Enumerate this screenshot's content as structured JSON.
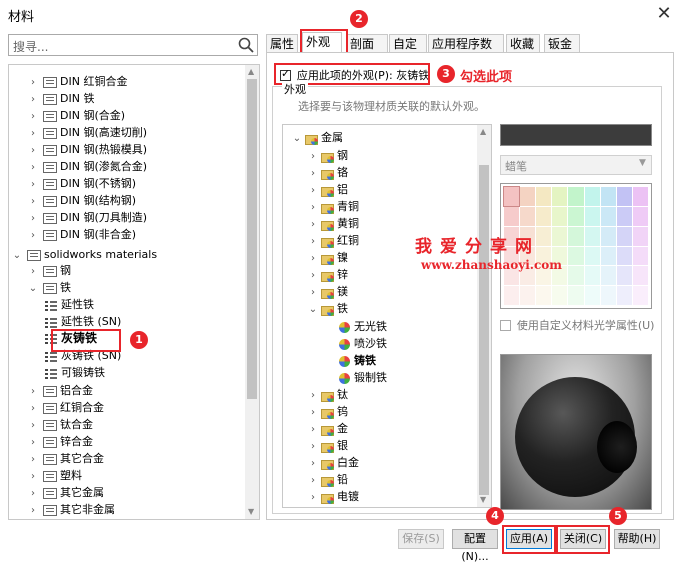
{
  "window": {
    "title": "材料",
    "close_glyph": "✕"
  },
  "search": {
    "placeholder": "搜寻..."
  },
  "left_tree": {
    "items": [
      {
        "label": "DIN 红铜合金",
        "type": "folder"
      },
      {
        "label": "DIN 铁",
        "type": "folder"
      },
      {
        "label": "DIN 钢(合金)",
        "type": "folder"
      },
      {
        "label": "DIN 钢(高速切削)",
        "type": "folder"
      },
      {
        "label": "DIN 钢(热锻模具)",
        "type": "folder"
      },
      {
        "label": "DIN 钢(渗氮合金)",
        "type": "folder"
      },
      {
        "label": "DIN 钢(不锈钢)",
        "type": "folder"
      },
      {
        "label": "DIN 钢(结构钢)",
        "type": "folder"
      },
      {
        "label": "DIN 钢(刀具制造)",
        "type": "folder"
      },
      {
        "label": "DIN 钢(非合金)",
        "type": "folder"
      },
      {
        "label": "solidworks materials",
        "type": "library"
      },
      {
        "label": "钢",
        "type": "folder"
      },
      {
        "label": "铁",
        "type": "folder"
      },
      {
        "label": "延性铁",
        "type": "material"
      },
      {
        "label": "延性铁 (SN)",
        "type": "material"
      },
      {
        "label": "灰铸铁",
        "type": "material"
      },
      {
        "label": "灰铸铁 (SN)",
        "type": "material"
      },
      {
        "label": "可锻铸铁",
        "type": "material"
      },
      {
        "label": "铝合金",
        "type": "folder"
      },
      {
        "label": "红铜合金",
        "type": "folder"
      },
      {
        "label": "钛合金",
        "type": "folder"
      },
      {
        "label": "锌合金",
        "type": "folder"
      },
      {
        "label": "其它合金",
        "type": "folder"
      },
      {
        "label": "塑料",
        "type": "folder"
      },
      {
        "label": "其它金属",
        "type": "folder"
      },
      {
        "label": "其它非金属",
        "type": "folder"
      }
    ]
  },
  "tabs": [
    {
      "label": "属性"
    },
    {
      "label": "外观"
    },
    {
      "label": "剖面线"
    },
    {
      "label": "自定义"
    },
    {
      "label": "应用程序数据"
    },
    {
      "label": "收藏"
    },
    {
      "label": "钣金"
    }
  ],
  "appearance": {
    "apply_checkbox_label": "应用此项的外观(P): 灰铸铁",
    "group_title": "外观",
    "description": "选择要与该物理材质关联的默认外观。",
    "tree": [
      {
        "label": "金属",
        "type": "folder"
      },
      {
        "label": "钢",
        "type": "folder"
      },
      {
        "label": "铬",
        "type": "folder"
      },
      {
        "label": "铝",
        "type": "folder"
      },
      {
        "label": "青铜",
        "type": "folder"
      },
      {
        "label": "黄铜",
        "type": "folder"
      },
      {
        "label": "红铜",
        "type": "folder"
      },
      {
        "label": "镍",
        "type": "folder"
      },
      {
        "label": "锌",
        "type": "folder"
      },
      {
        "label": "镁",
        "type": "folder"
      },
      {
        "label": "铁",
        "type": "folder"
      },
      {
        "label": "无光铁",
        "type": "item"
      },
      {
        "label": "喷沙铁",
        "type": "item"
      },
      {
        "label": "铸铁",
        "type": "item"
      },
      {
        "label": "锻制铁",
        "type": "item"
      },
      {
        "label": "钛",
        "type": "folder"
      },
      {
        "label": "钨",
        "type": "folder"
      },
      {
        "label": "金",
        "type": "folder"
      },
      {
        "label": "银",
        "type": "folder"
      },
      {
        "label": "白金",
        "type": "folder"
      },
      {
        "label": "铅",
        "type": "folder"
      },
      {
        "label": "电镀",
        "type": "folder"
      }
    ],
    "color_swatch": "#3c3c3c",
    "brush_select": "蜡笔",
    "custom_optics_label": "使用自定义材料光学属性(U)"
  },
  "annotations": {
    "step1": "1",
    "step2": "2",
    "step3": "3",
    "step3_text": "勾选此项",
    "step4": "4",
    "step5": "5",
    "watermark_cn": "我爱分享网",
    "watermark_url": "www.zhanshaoyi.com",
    "accent": "#e8252b"
  },
  "buttons": {
    "save": "保存(S)",
    "config": "配置(N)...",
    "apply": "应用(A)",
    "close": "关闭(C)",
    "help": "帮助(H)"
  }
}
